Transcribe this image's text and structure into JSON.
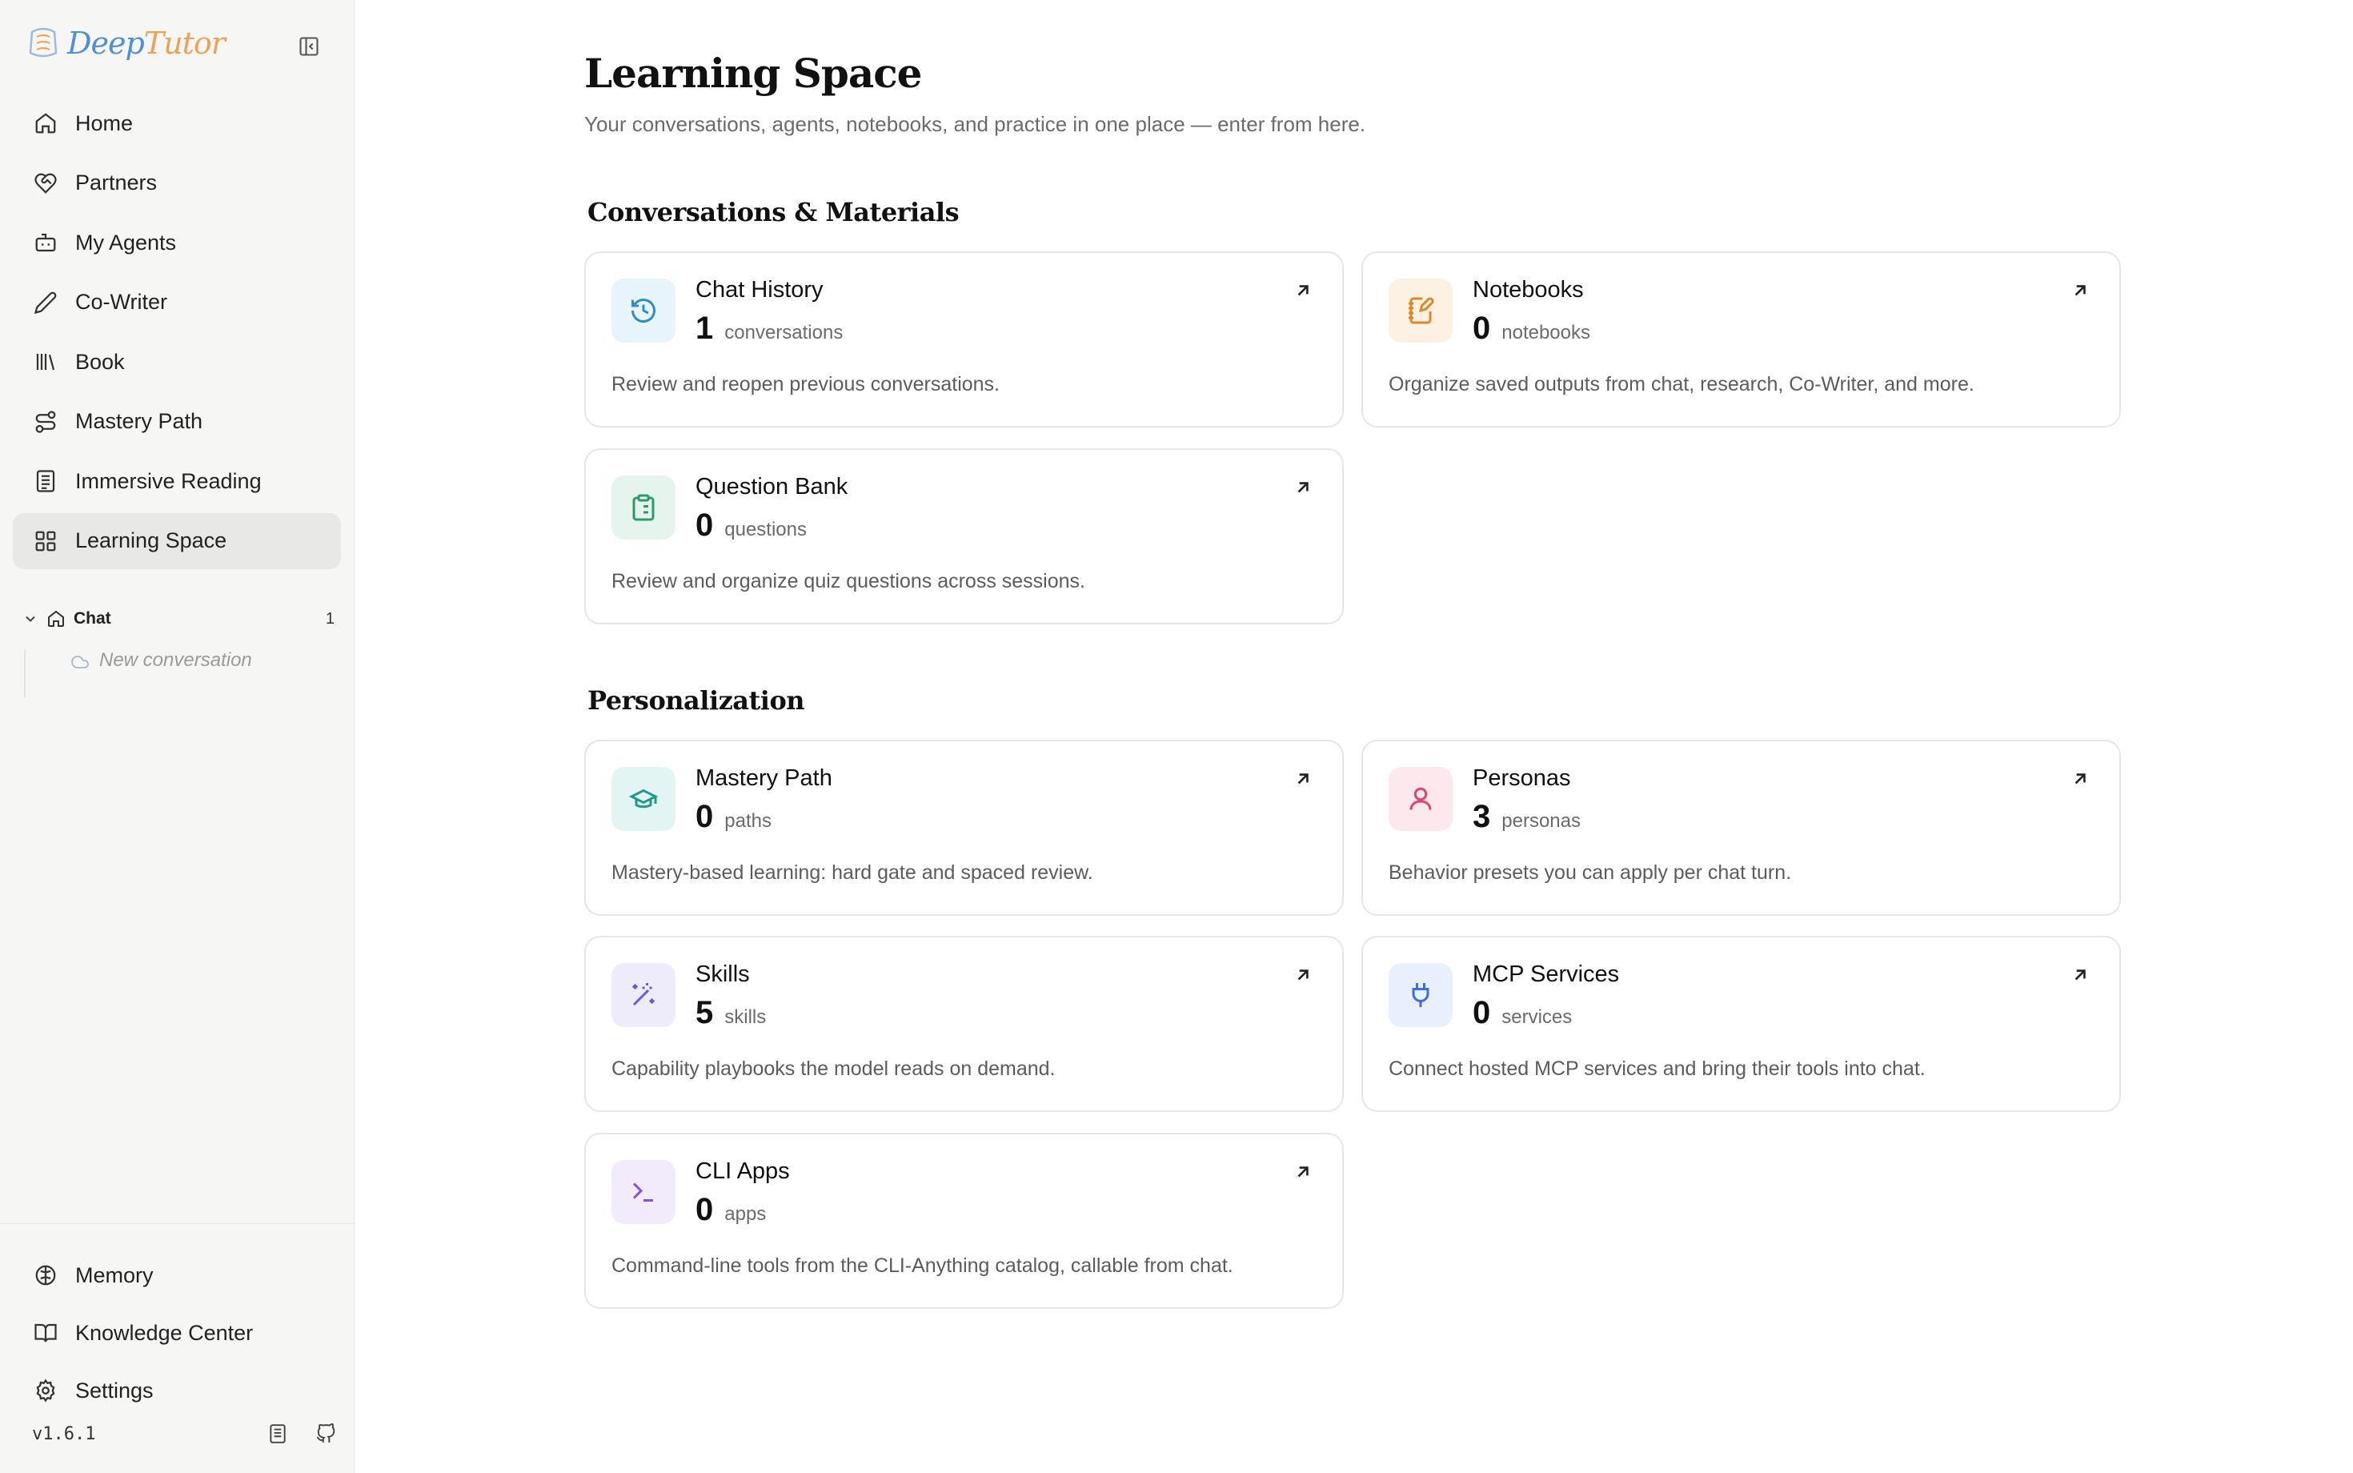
{
  "app": {
    "logo_deep": "Deep",
    "logo_tutor": "Tutor",
    "version": "v1.6.1"
  },
  "sidebar": {
    "items": [
      {
        "label": "Home",
        "icon": "home-icon"
      },
      {
        "label": "Partners",
        "icon": "heart-handshake-icon"
      },
      {
        "label": "My Agents",
        "icon": "bot-icon"
      },
      {
        "label": "Co-Writer",
        "icon": "pen-icon"
      },
      {
        "label": "Book",
        "icon": "library-icon"
      },
      {
        "label": "Mastery Path",
        "icon": "route-icon"
      },
      {
        "label": "Immersive Reading",
        "icon": "document-icon"
      },
      {
        "label": "Learning Space",
        "icon": "grid-icon",
        "active": true
      }
    ],
    "tree": {
      "label": "Chat",
      "count": "1",
      "child": "New conversation"
    },
    "bottom": [
      {
        "label": "Memory",
        "icon": "brain-icon"
      },
      {
        "label": "Knowledge Center",
        "icon": "book-open-icon"
      },
      {
        "label": "Settings",
        "icon": "gear-icon"
      }
    ]
  },
  "main": {
    "title": "Learning Space",
    "subtitle": "Your conversations, agents, notebooks, and practice in one place — enter from here.",
    "sections": [
      {
        "title": "Conversations & Materials",
        "cards": [
          {
            "title": "Chat History",
            "count": "1",
            "unit": "conversations",
            "desc": "Review and reopen previous conversations.",
            "icon": "history-icon",
            "bg": "#e7f4fb",
            "fg": "#2f8fc0"
          },
          {
            "title": "Notebooks",
            "count": "0",
            "unit": "notebooks",
            "desc": "Organize saved outputs from chat, research, Co-Writer, and more.",
            "icon": "notebook-pen-icon",
            "bg": "#fdf1e3",
            "fg": "#d98a26"
          },
          {
            "title": "Question Bank",
            "count": "0",
            "unit": "questions",
            "desc": "Review and organize quiz questions across sessions.",
            "icon": "clipboard-list-icon",
            "bg": "#e5f5ee",
            "fg": "#2e9a6a"
          }
        ]
      },
      {
        "title": "Personalization",
        "cards": [
          {
            "title": "Mastery Path",
            "count": "0",
            "unit": "paths",
            "desc": "Mastery-based learning: hard gate and spaced review.",
            "icon": "graduation-cap-icon",
            "bg": "#e3f5f2",
            "fg": "#1f9a8a"
          },
          {
            "title": "Personas",
            "count": "3",
            "unit": "personas",
            "desc": "Behavior presets you can apply per chat turn.",
            "icon": "user-icon",
            "bg": "#fde8ee",
            "fg": "#e0456f"
          },
          {
            "title": "Skills",
            "count": "5",
            "unit": "skills",
            "desc": "Capability playbooks the model reads on demand.",
            "icon": "wand-sparkles-icon",
            "bg": "#eeebfb",
            "fg": "#6a5bd6"
          },
          {
            "title": "MCP Services",
            "count": "0",
            "unit": "services",
            "desc": "Connect hosted MCP services and bring their tools into chat.",
            "icon": "plug-icon",
            "bg": "#e8effd",
            "fg": "#3d6fe0"
          },
          {
            "title": "CLI Apps",
            "count": "0",
            "unit": "apps",
            "desc": "Command-line tools from the CLI-Anything catalog, callable from chat.",
            "icon": "terminal-icon",
            "bg": "#f1ebfc",
            "fg": "#8a4fe0"
          }
        ]
      }
    ]
  }
}
